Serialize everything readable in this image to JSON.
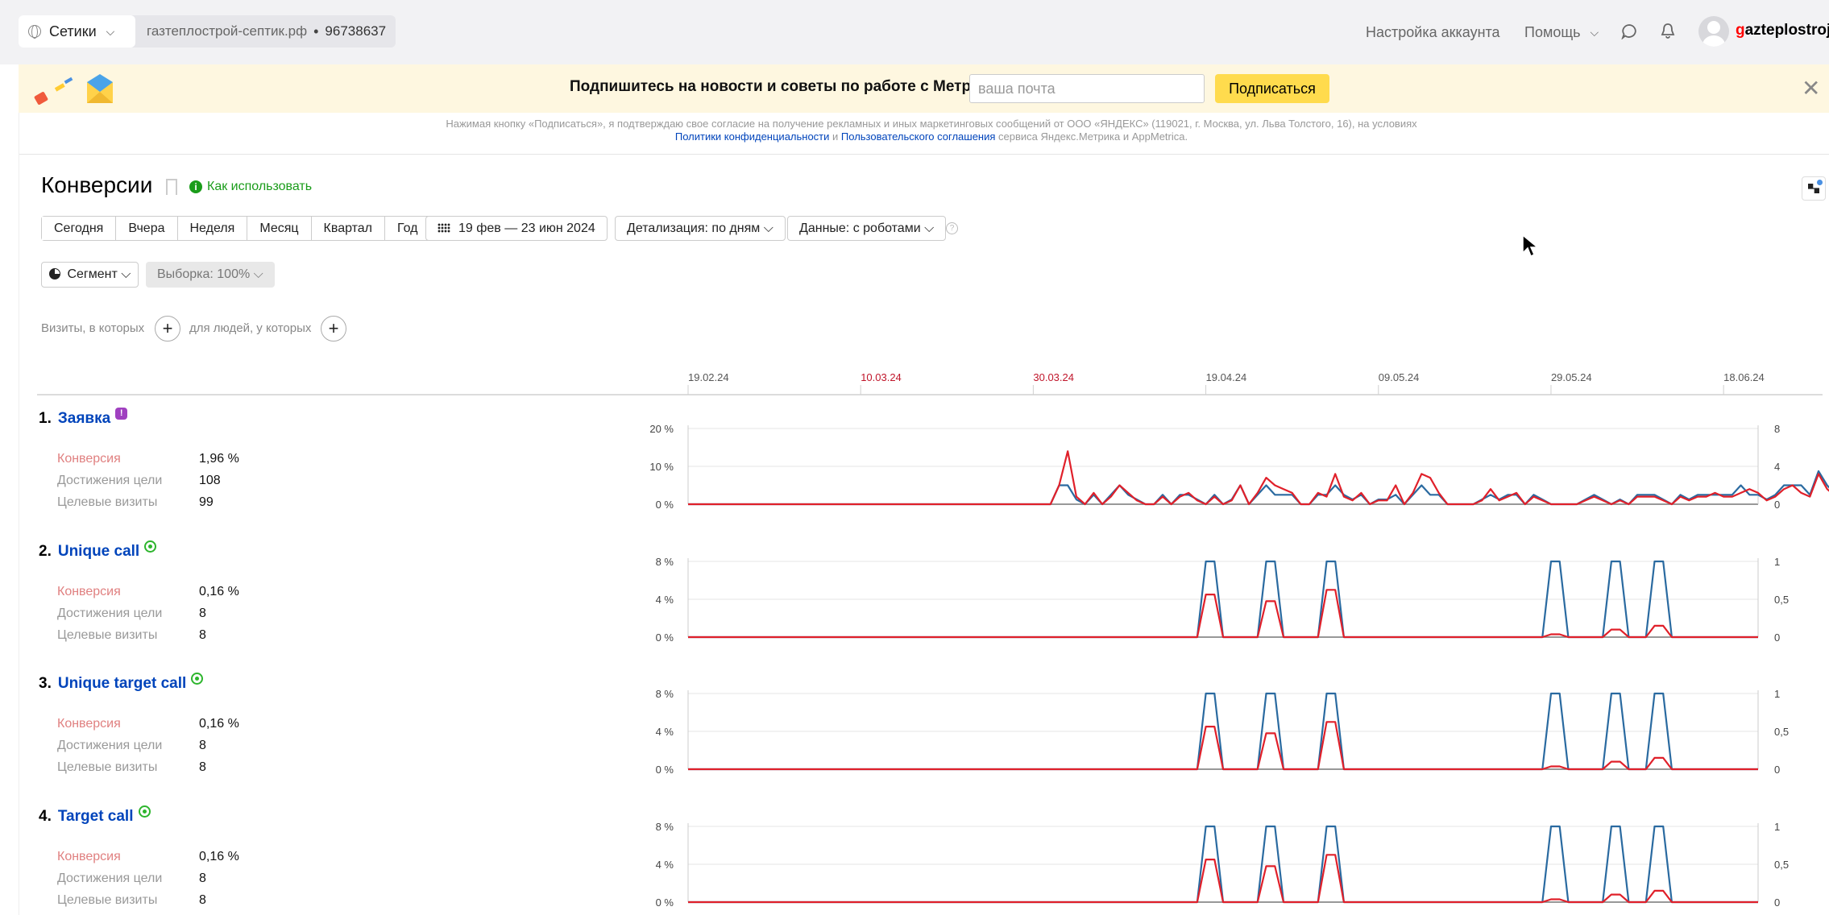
{
  "topbar": {
    "counter_menu": "Сетики",
    "site": "газтеплострой-септик.рф",
    "separator": "•",
    "counter_id": "96738637",
    "account_settings": "Настройка аккаунта",
    "help": "Помощь",
    "login_first": "g",
    "login_rest": "azteplostroj-s"
  },
  "promo": {
    "title": "Подпишитесь на новости и советы по работе с Метрикой",
    "email_placeholder": "ваша почта",
    "subscribe": "Подписаться",
    "legal_line1": "Нажимая кнопку «Подписаться», я подтверждаю свое согласие на получение рекламных и иных маркетинговых сообщений от ООО «ЯНДЕКС» (119021, г. Москва, ул. Льва Толстого, 16), на условиях",
    "legal_link1": "Политики конфиденциальности",
    "legal_and": " и ",
    "legal_link2": "Пользовательского соглашения",
    "legal_tail": " сервиса Яндекс.Метрика и AppMetrica."
  },
  "page": {
    "title": "Конверсии",
    "how_to": "Как использовать",
    "periods": [
      "Сегодня",
      "Вчера",
      "Неделя",
      "Месяц",
      "Квартал",
      "Год"
    ],
    "date_range": "19 фев — 23 июн 2024",
    "detail": "Детализация: по дням",
    "data_mode": "Данные: с роботами",
    "segment": "Сегмент",
    "sample": "Выборка: 100%",
    "filter_visits": "Визиты, в которых",
    "filter_people": "для людей, у которых",
    "plus": "+"
  },
  "timeline": {
    "labels": [
      "19.02.24",
      "10.03.24",
      "30.03.24",
      "19.04.24",
      "09.05.24",
      "29.05.24",
      "18.06.24"
    ],
    "holiday_labels": [
      "10.03.24",
      "30.03.24"
    ]
  },
  "metric_names": {
    "conversion": "Конверсия",
    "reaches": "Достижения цели",
    "target_visits": "Целевые визиты"
  },
  "goals": [
    {
      "num": "1.",
      "name": "Заявка",
      "badge": "purple",
      "conversion": "1,96 %",
      "reaches": "108",
      "visits": "99",
      "left_ticks": [
        "20 %",
        "10 %",
        "0 %"
      ],
      "right_ticks": [
        "8",
        "4",
        "0"
      ]
    },
    {
      "num": "2.",
      "name": "Unique call",
      "badge": "green",
      "conversion": "0,16 %",
      "reaches": "8",
      "visits": "8",
      "left_ticks": [
        "8 %",
        "4 %",
        "0 %"
      ],
      "right_ticks": [
        "1",
        "0,5",
        "0"
      ]
    },
    {
      "num": "3.",
      "name": "Unique target call",
      "badge": "green",
      "conversion": "0,16 %",
      "reaches": "8",
      "visits": "8",
      "left_ticks": [
        "8 %",
        "4 %",
        "0 %"
      ],
      "right_ticks": [
        "1",
        "0,5",
        "0"
      ]
    },
    {
      "num": "4.",
      "name": "Target call",
      "badge": "green",
      "conversion": "0,16 %",
      "reaches": "8",
      "visits": "8",
      "left_ticks": [
        "8 %",
        "4 %",
        "0 %"
      ],
      "right_ticks": [
        "1",
        "0,5",
        "0"
      ]
    }
  ],
  "colors": {
    "conversion_line": "#e0202a",
    "visits_line": "#2a6aa0",
    "holiday_label": "#c0152a",
    "link": "#0044bb"
  },
  "chart_data": [
    {
      "type": "line",
      "title": "Заявка",
      "x_start": "19.02.24",
      "x_end": "23.06.24",
      "ylim_left": [
        0,
        20
      ],
      "ylim_right": [
        0,
        8
      ],
      "series": [
        {
          "name": "Конверсия",
          "axis": "left",
          "values": [
            0,
            0,
            0,
            0,
            0,
            0,
            0,
            0,
            0,
            0,
            0,
            0,
            0,
            0,
            0,
            0,
            0,
            0,
            0,
            0,
            0,
            0,
            0,
            0,
            0,
            0,
            0,
            0,
            0,
            0,
            0,
            0,
            0,
            0,
            0,
            0,
            0,
            0,
            0,
            0,
            0,
            0,
            0,
            5,
            14,
            2,
            0,
            3,
            0,
            2,
            5,
            3,
            1,
            0,
            0,
            2,
            0,
            2,
            3,
            1,
            0,
            2,
            0,
            1,
            5,
            0,
            3,
            7,
            5,
            4,
            3,
            0,
            0,
            3,
            2,
            8,
            2,
            1,
            3,
            0,
            1,
            1,
            5,
            0,
            3,
            8,
            7,
            3,
            0,
            0,
            0,
            0,
            1,
            4,
            1,
            2,
            3,
            0,
            2,
            1,
            0,
            0,
            0,
            0,
            1,
            2,
            1,
            0,
            1,
            0,
            2,
            2,
            2,
            1,
            0,
            2,
            1,
            2,
            2,
            3,
            2,
            2,
            3,
            4,
            3,
            1,
            2,
            4,
            5,
            3,
            2,
            8,
            4,
            2,
            0
          ]
        },
        {
          "name": "Целевые визиты",
          "axis": "right",
          "values": [
            0,
            0,
            0,
            0,
            0,
            0,
            0,
            0,
            0,
            0,
            0,
            0,
            0,
            0,
            0,
            0,
            0,
            0,
            0,
            0,
            0,
            0,
            0,
            0,
            0,
            0,
            0,
            0,
            0,
            0,
            0,
            0,
            0,
            0,
            0,
            0,
            0,
            0,
            0,
            0,
            0,
            0,
            0,
            2,
            2,
            0.5,
            0,
            1,
            0,
            1,
            2,
            1,
            0.5,
            0,
            0,
            1,
            0,
            1,
            1,
            0.5,
            0,
            1,
            0,
            0.5,
            2,
            0,
            1,
            2,
            1,
            1,
            1,
            0,
            0,
            1,
            1,
            2,
            1,
            0.5,
            1,
            0,
            0.5,
            0.5,
            1,
            0,
            1,
            2,
            1,
            1,
            0,
            0,
            0,
            0,
            0.5,
            1,
            0.5,
            1,
            1,
            0,
            1,
            0.5,
            0,
            0,
            0,
            0,
            0.5,
            1,
            0.5,
            0,
            0.5,
            0,
            1,
            1,
            1,
            0.5,
            0,
            1,
            0.5,
            1,
            1,
            1,
            1,
            1,
            2,
            1,
            1,
            0.5,
            1,
            2,
            2,
            2,
            1,
            3.5,
            2,
            1,
            0
          ]
        }
      ]
    },
    {
      "type": "line",
      "title": "Unique call",
      "ylim_left": [
        0,
        8
      ],
      "ylim_right": [
        0,
        1
      ],
      "peaks": [
        {
          "date": "19.04.24",
          "conv": 4.5,
          "visits": 1
        },
        {
          "date": "26.04.24",
          "conv": 3.8,
          "visits": 1
        },
        {
          "date": "03.05.24",
          "conv": 5,
          "visits": 1
        },
        {
          "date": "29.05.24",
          "conv": 0.3,
          "visits": 1
        },
        {
          "date": "05.06.24",
          "conv": 0.8,
          "visits": 1
        },
        {
          "date": "10.06.24",
          "conv": 1.2,
          "visits": 1
        }
      ]
    },
    {
      "type": "line",
      "title": "Unique target call",
      "ylim_left": [
        0,
        8
      ],
      "ylim_right": [
        0,
        1
      ],
      "peaks": [
        {
          "date": "19.04.24",
          "conv": 4.5,
          "visits": 1
        },
        {
          "date": "26.04.24",
          "conv": 3.8,
          "visits": 1
        },
        {
          "date": "03.05.24",
          "conv": 5,
          "visits": 1
        },
        {
          "date": "29.05.24",
          "conv": 0.3,
          "visits": 1
        },
        {
          "date": "05.06.24",
          "conv": 0.8,
          "visits": 1
        },
        {
          "date": "10.06.24",
          "conv": 1.2,
          "visits": 1
        }
      ]
    },
    {
      "type": "line",
      "title": "Target call",
      "ylim_left": [
        0,
        8
      ],
      "ylim_right": [
        0,
        1
      ],
      "peaks": [
        {
          "date": "19.04.24",
          "conv": 4.5,
          "visits": 1
        },
        {
          "date": "26.04.24",
          "conv": 3.8,
          "visits": 1
        },
        {
          "date": "03.05.24",
          "conv": 5,
          "visits": 1
        },
        {
          "date": "29.05.24",
          "conv": 0.3,
          "visits": 1
        },
        {
          "date": "05.06.24",
          "conv": 0.8,
          "visits": 1
        },
        {
          "date": "10.06.24",
          "conv": 1.2,
          "visits": 1
        }
      ]
    }
  ]
}
